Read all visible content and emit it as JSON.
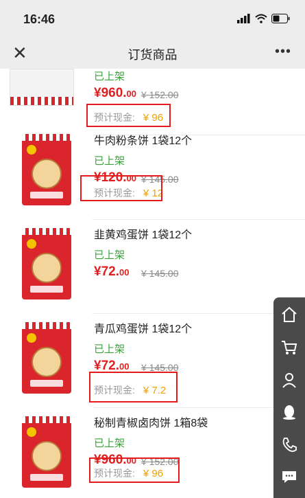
{
  "status_bar": {
    "time": "16:46"
  },
  "nav": {
    "title": "订货商品",
    "close_label": "✕",
    "more_label": "•••"
  },
  "items": [
    {
      "name": "",
      "status": "已上架",
      "price_main": "¥960.",
      "price_cents": "00",
      "orig_price": "¥ 152.00",
      "est_label": "预计现金:",
      "est_value": "¥ 96"
    },
    {
      "name": "牛肉粉条饼 1袋12个",
      "status": "已上架",
      "price_main": "¥120.",
      "price_cents": "00",
      "orig_price": "¥ 145.00",
      "est_label": "预计现金:",
      "est_value": "¥ 12"
    },
    {
      "name": "韭黄鸡蛋饼 1袋12个",
      "status": "已上架",
      "price_main": "¥72.",
      "price_cents": "00",
      "orig_price": "¥ 145.00",
      "est_label": "",
      "est_value": ""
    },
    {
      "name": "青瓜鸡蛋饼 1袋12个",
      "status": "已上架",
      "price_main": "¥72.",
      "price_cents": "00",
      "orig_price": "¥ 145.00",
      "est_label": "预计现金:",
      "est_value": "¥ 7.2"
    },
    {
      "name": "秘制青椒卤肉饼 1箱8袋",
      "status": "已上架",
      "price_main": "¥960.",
      "price_cents": "00",
      "orig_price": "¥ 152.00",
      "est_label": "预计现金:",
      "est_value": "¥ 96"
    }
  ],
  "sidebar": [
    "home-icon",
    "cart-icon",
    "user-icon",
    "qq-icon",
    "phone-icon",
    "chat-icon"
  ],
  "colors": {
    "price_red": "#e02020",
    "status_green": "#3aa13a",
    "est_orange": "#f2a100",
    "highlight_red": "#e51b1b",
    "sidebar_bg": "#4a4a4a"
  }
}
